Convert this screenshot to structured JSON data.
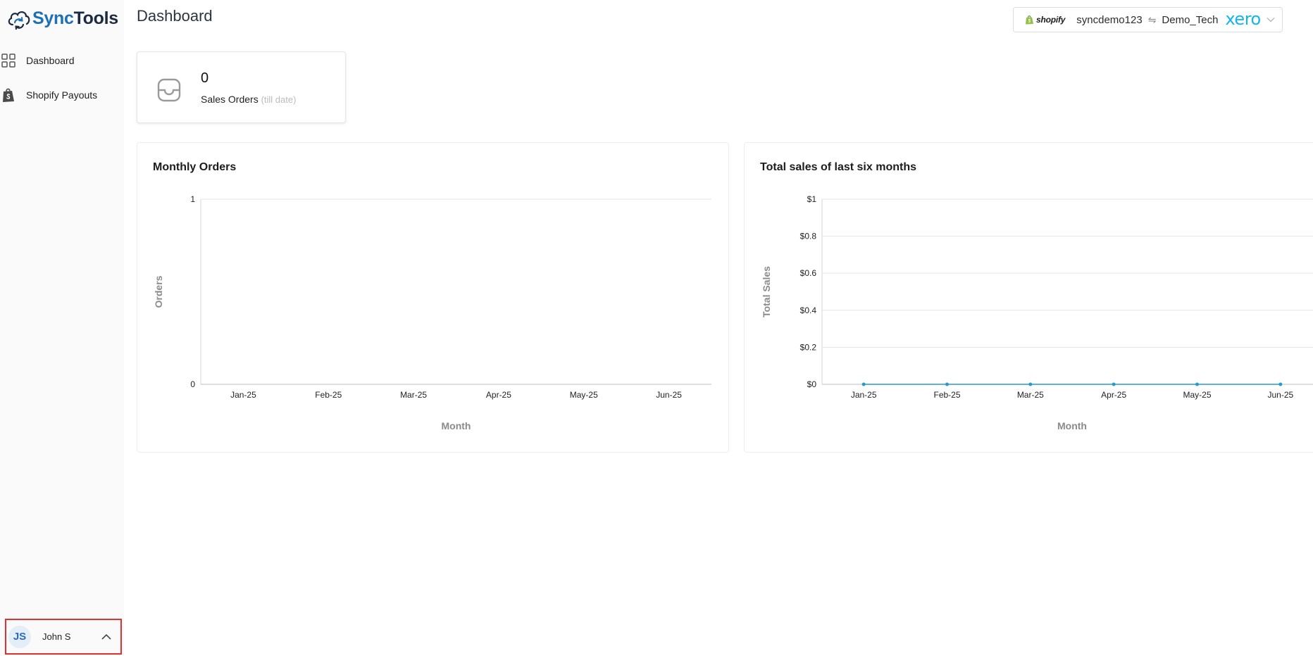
{
  "app": {
    "logo_sync": "Sync",
    "logo_tools": "Tools"
  },
  "sidebar": {
    "items": [
      {
        "label": "Dashboard",
        "icon": "grid-icon"
      },
      {
        "label": "Shopify Payouts",
        "icon": "shopify-bag-icon"
      }
    ],
    "user": {
      "initials": "JS",
      "name": "John S"
    }
  },
  "header": {
    "title": "Dashboard",
    "connection": {
      "shopify_label": "shopify",
      "store": "syncdemo123",
      "arrows": "⇋",
      "org": "Demo_Tech",
      "xero_label": "xero"
    }
  },
  "stats": {
    "sales_orders": {
      "value": "0",
      "label": "Sales Orders",
      "sub": "(till date)"
    }
  },
  "colors": {
    "brand_blue": "#1d6fb8",
    "xero_blue": "#13b5ea",
    "highlight_red": "#e03131",
    "point_teal": "#2a9bc9"
  },
  "chart_data": [
    {
      "type": "bar",
      "title": "Monthly Orders",
      "categories": [
        "Jan-25",
        "Feb-25",
        "Mar-25",
        "Apr-25",
        "May-25",
        "Jun-25"
      ],
      "values": [
        0,
        0,
        0,
        0,
        0,
        0
      ],
      "xlabel": "Month",
      "ylabel": "Orders",
      "ylim": [
        0,
        1
      ],
      "yticks": [
        "0",
        "1"
      ],
      "grid": true
    },
    {
      "type": "line",
      "title": "Total sales of last six months",
      "categories": [
        "Jan-25",
        "Feb-25",
        "Mar-25",
        "Apr-25",
        "May-25",
        "Jun-25"
      ],
      "values": [
        0,
        0,
        0,
        0,
        0,
        0
      ],
      "xlabel": "Month",
      "ylabel": "Total Sales",
      "ylim": [
        0,
        1
      ],
      "yticks": [
        "$0",
        "$0.2",
        "$0.4",
        "$0.6",
        "$0.8",
        "$1"
      ],
      "grid": true
    }
  ]
}
